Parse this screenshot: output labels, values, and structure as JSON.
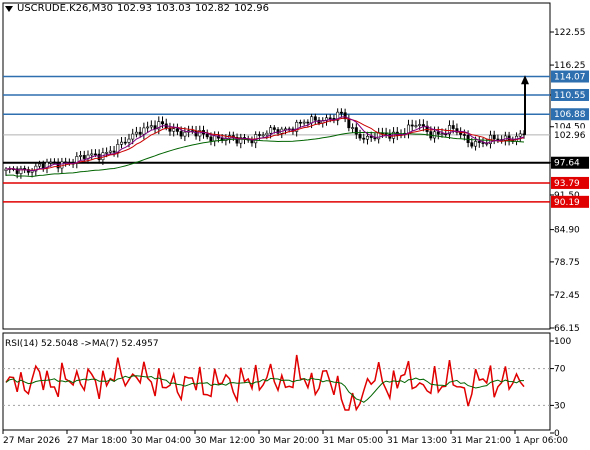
{
  "header": {
    "symbol": "USCRUDE.K26,M30",
    "open": "102.93",
    "high": "103.03",
    "low": "102.82",
    "close": "102.96"
  },
  "rsi_header": "RSI(14) 52.5048   ->MA(7) 52.4957",
  "colors": {
    "candle": "#000000",
    "ma_fast": "#cc0000",
    "ma_slow": "#006400",
    "ma_mid": "#800080",
    "blue_level": "#1f5f9f",
    "red_level": "#e00000",
    "rsi": "#e00000",
    "rsi_ma": "#006400"
  },
  "price_axis": [
    "122.55",
    "116.25",
    "110.55",
    "104.50",
    "97.64",
    "91.50",
    "84.90",
    "78.75",
    "72.45",
    "66.15"
  ],
  "levels": [
    {
      "price": 114.07,
      "label": "114.07",
      "color": "#2e6fb0"
    },
    {
      "price": 110.55,
      "label": "110.55",
      "color": "#2e6fb0"
    },
    {
      "price": 106.88,
      "label": "106.88",
      "color": "#2e6fb0"
    },
    {
      "price": 97.64,
      "label": "97.64",
      "color": "#000000"
    },
    {
      "price": 93.79,
      "label": "93.79",
      "color": "#e00000"
    },
    {
      "price": 90.19,
      "label": "90.19",
      "color": "#e00000"
    }
  ],
  "current_price": {
    "price": 102.96,
    "label": "102.96"
  },
  "rsi_axis": [
    "100",
    "70",
    "30",
    "0"
  ],
  "time_axis": [
    "27 Mar 2026",
    "27 Mar 18:00",
    "30 Mar 04:00",
    "30 Mar 12:00",
    "30 Mar 20:00",
    "31 Mar 05:00",
    "31 Mar 13:00",
    "31 Mar 21:00",
    "1 Apr 06:00"
  ]
}
